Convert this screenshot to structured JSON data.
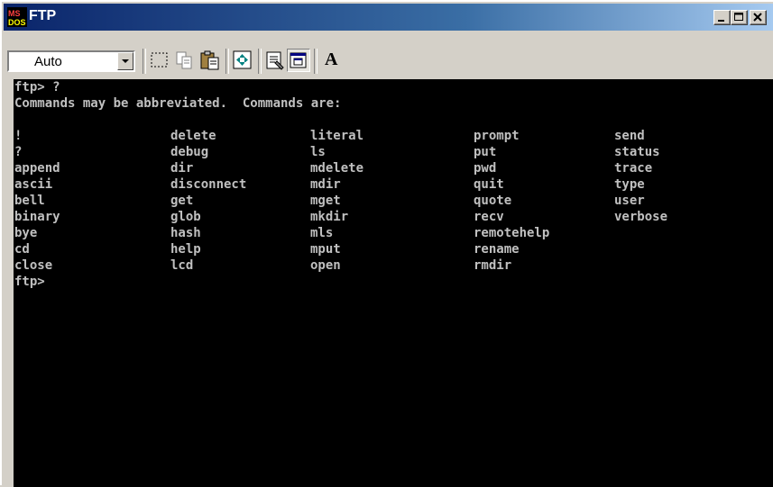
{
  "window": {
    "title": "FTP",
    "icon": "ms-dos-icon",
    "controls": [
      "minimize-icon",
      "maximize-icon",
      "close-icon"
    ]
  },
  "toolbar": {
    "font_size_value": "Auto",
    "buttons": [
      "mark-icon",
      "copy-icon",
      "paste-icon",
      "fullscreen-icon",
      "properties-icon",
      "background-icon",
      "font-icon"
    ],
    "font_button_label": "A"
  },
  "terminal": {
    "line1": "ftp> ?",
    "line2": "Commands may be abbreviated.  Commands are:",
    "prompt": "ftp>",
    "columns": [
      [
        "!",
        "?",
        "append",
        "ascii",
        "bell",
        "binary",
        "bye",
        "cd",
        "close"
      ],
      [
        "delete",
        "debug",
        "dir",
        "disconnect",
        "get",
        "glob",
        "hash",
        "help",
        "lcd"
      ],
      [
        "literal",
        "ls",
        "mdelete",
        "mdir",
        "mget",
        "mkdir",
        "mls",
        "mput",
        "open"
      ],
      [
        "prompt",
        "put",
        "pwd",
        "quit",
        "quote",
        "recv",
        "remotehelp",
        "rename",
        "rmdir"
      ],
      [
        "send",
        "status",
        "trace",
        "type",
        "user",
        "verbose"
      ]
    ]
  },
  "colors": {
    "terminal_bg": "#000000",
    "terminal_fg": "#c0c0c0",
    "title_bar": "#0a246a"
  }
}
